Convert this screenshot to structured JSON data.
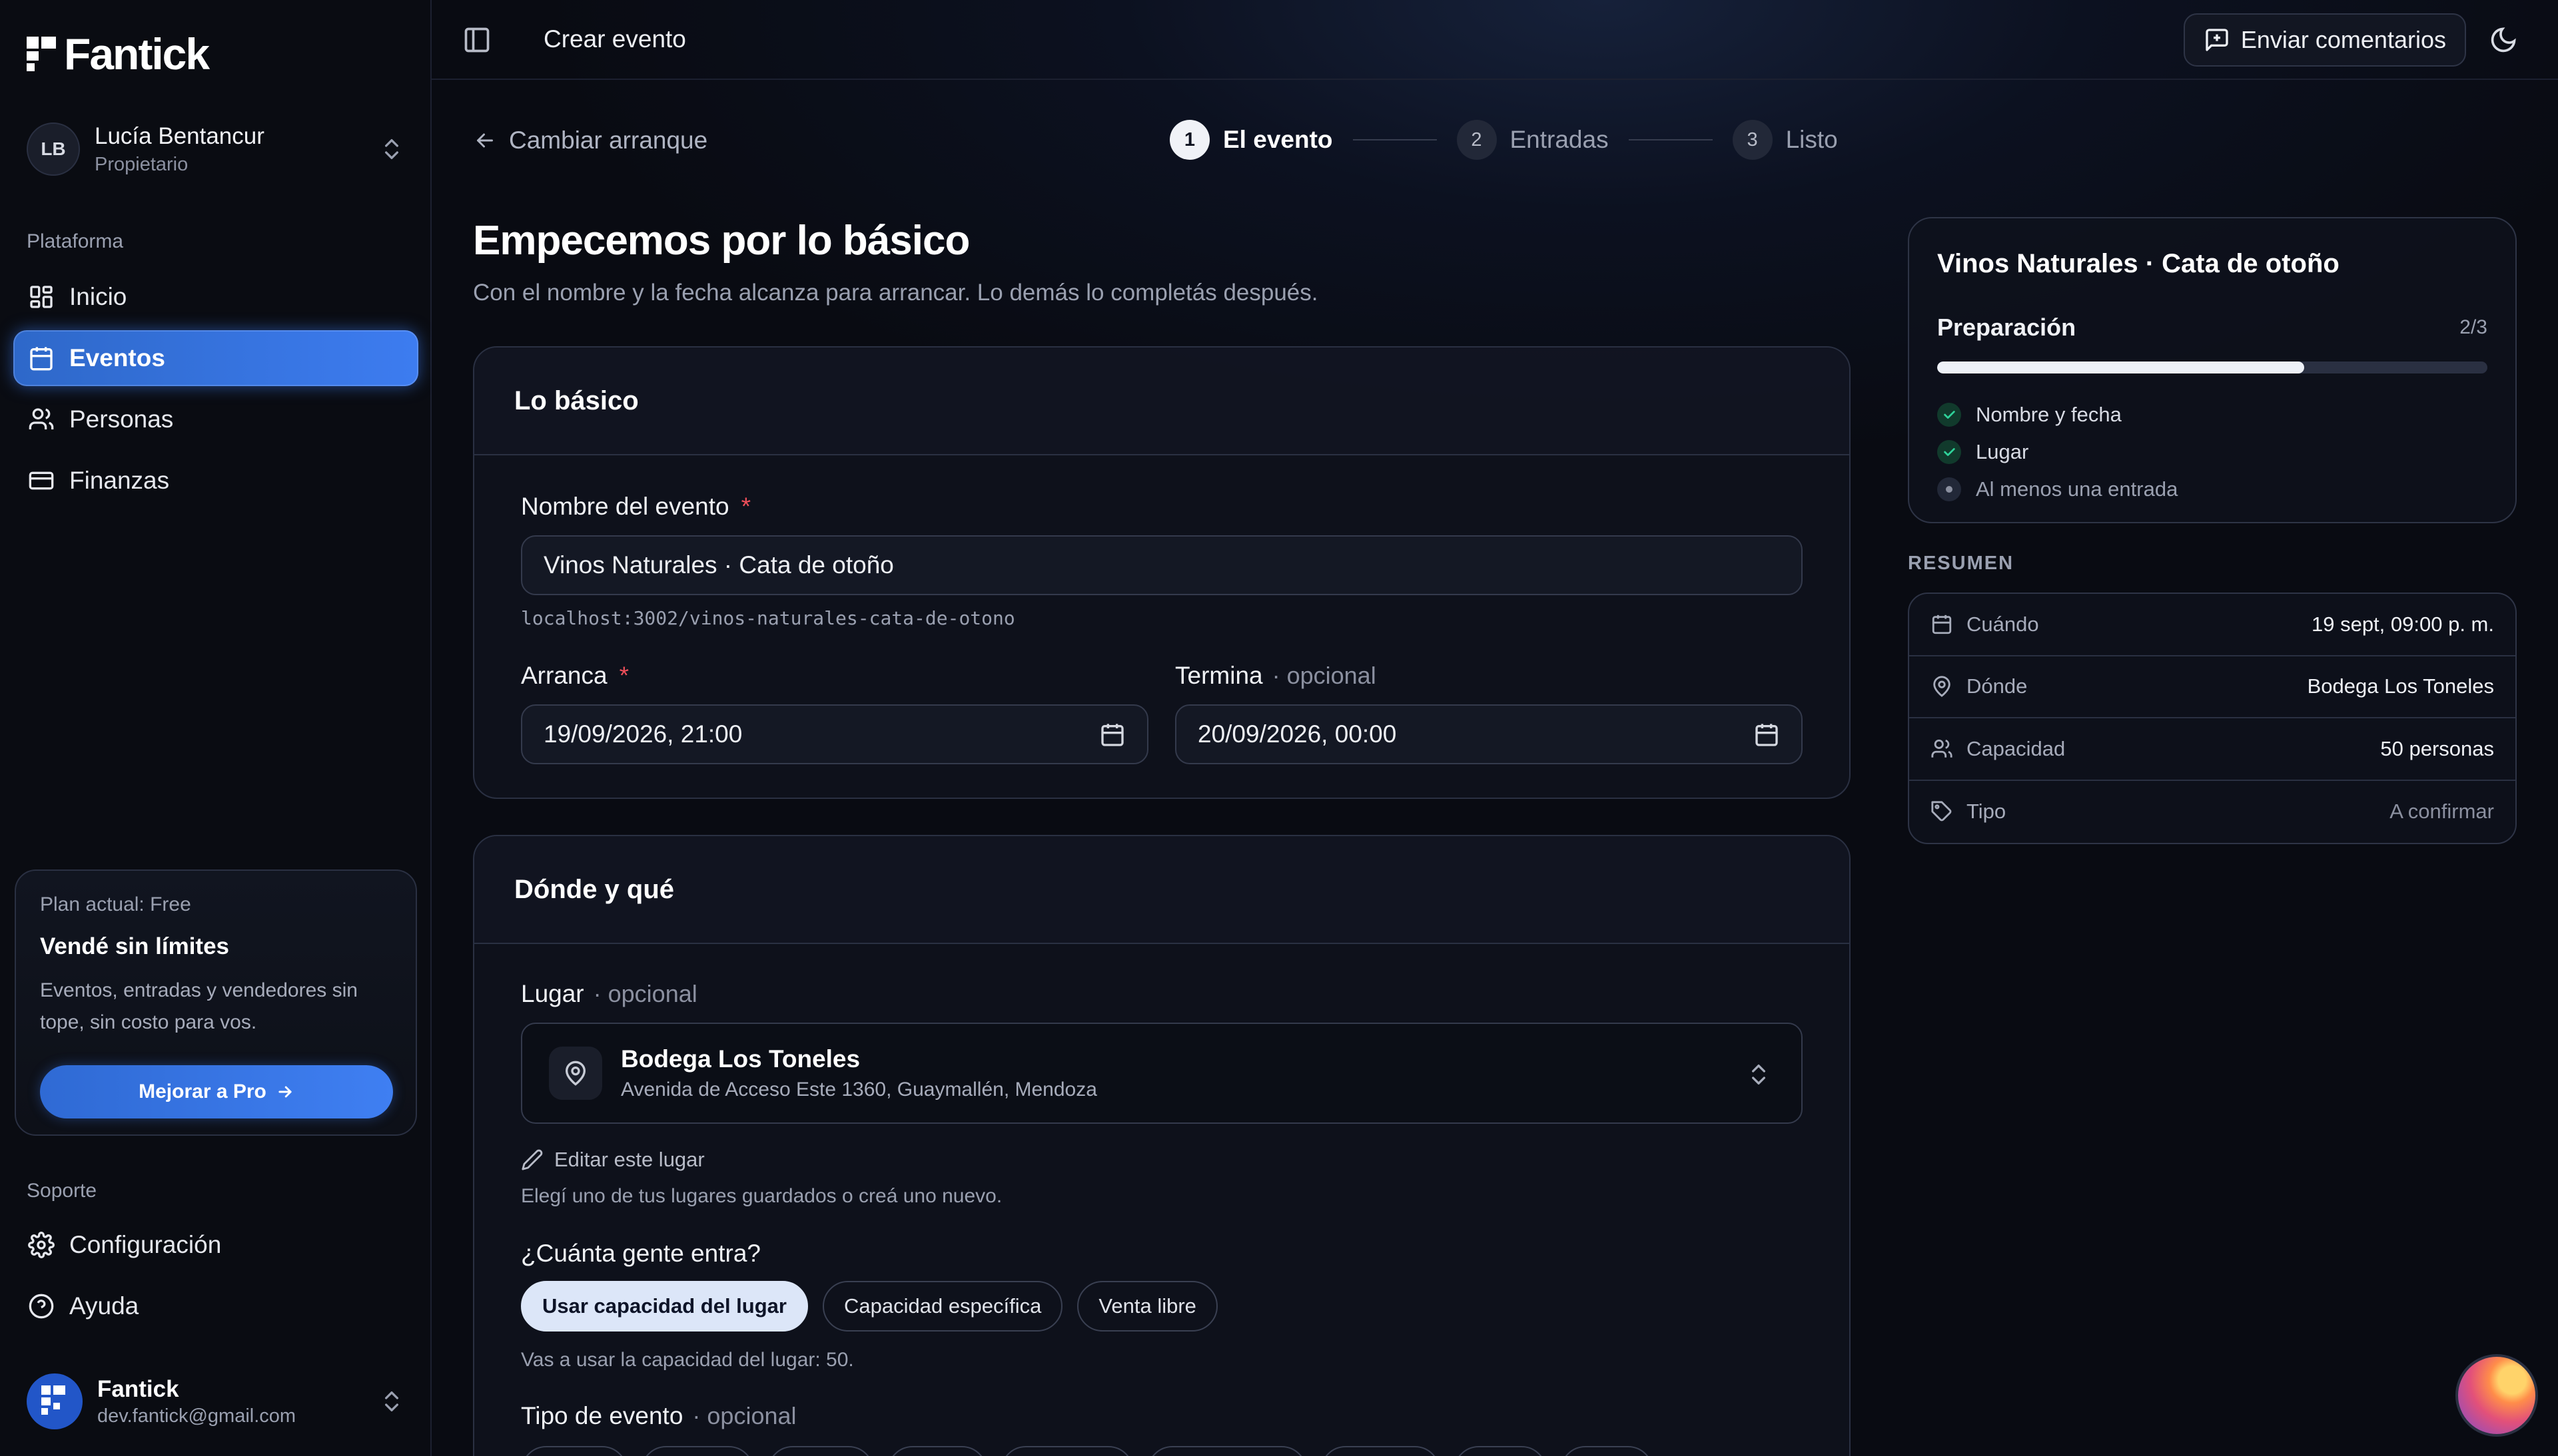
{
  "brand": {
    "name": "Fantick"
  },
  "user": {
    "initials": "LB",
    "name": "Lucía Bentancur",
    "role": "Propietario"
  },
  "nav": {
    "section_label": "Plataforma",
    "items": [
      {
        "label": "Inicio",
        "icon": "dashboard-icon"
      },
      {
        "label": "Eventos",
        "icon": "calendar-icon",
        "active": true
      },
      {
        "label": "Personas",
        "icon": "users-icon"
      },
      {
        "label": "Finanzas",
        "icon": "wallet-icon"
      }
    ]
  },
  "plan": {
    "label": "Plan actual: Free",
    "title": "Vendé sin límites",
    "desc_line1": "Eventos, entradas y vendedores sin",
    "desc_line2": "tope, sin costo para vos.",
    "cta": "Mejorar a Pro"
  },
  "support": {
    "section_label": "Soporte",
    "items": [
      {
        "label": "Configuración",
        "icon": "gear-icon"
      },
      {
        "label": "Ayuda",
        "icon": "help-icon"
      }
    ]
  },
  "account": {
    "name": "Fantick",
    "email": "dev.fantick@gmail.com"
  },
  "topbar": {
    "title": "Crear evento",
    "feedback": "Enviar comentarios"
  },
  "back_link": "Cambiar arranque",
  "steps": [
    {
      "num": "1",
      "label": "El evento",
      "active": true
    },
    {
      "num": "2",
      "label": "Entradas"
    },
    {
      "num": "3",
      "label": "Listo"
    }
  ],
  "page": {
    "title": "Empecemos por lo básico",
    "subtitle": "Con el nombre y la fecha alcanza para arrancar. Lo demás lo completás después."
  },
  "basics": {
    "heading": "Lo básico",
    "name_label": "Nombre del evento",
    "required_mark": "*",
    "name_value": "Vinos Naturales · Cata de otoño",
    "slug": "localhost:3002/vinos-naturales-cata-de-otono",
    "start_label": "Arranca",
    "start_value": "19/09/2026, 21:00",
    "end_label": "Termina",
    "optional": "· opcional",
    "end_value": "20/09/2026, 00:00"
  },
  "where": {
    "heading": "Dónde y qué",
    "venue_label": "Lugar",
    "venue_name": "Bodega Los Toneles",
    "venue_address": "Avenida de Acceso Este 1360, Guaymallén, Mendoza",
    "edit_venue": "Editar este lugar",
    "venue_hint": "Elegí uno de tus lugares guardados o creá uno nuevo.",
    "capacity_label": "¿Cuánta gente entra?",
    "capacity_options": [
      "Usar capacidad del lugar",
      "Capacidad específica",
      "Venta libre"
    ],
    "capacity_selected": 0,
    "capacity_hint": "Vas a usar la capacidad del lugar: 50.",
    "type_label": "Tipo de evento"
  },
  "prep": {
    "title": "Vinos Naturales · Cata de otoño",
    "label": "Preparación",
    "count": "2/3",
    "progress": 0.667,
    "items": [
      {
        "label": "Nombre y fecha",
        "done": true
      },
      {
        "label": "Lugar",
        "done": true
      },
      {
        "label": "Al menos una entrada",
        "done": false
      }
    ]
  },
  "summary": {
    "label": "RESUMEN",
    "rows": [
      {
        "key": "Cuándo",
        "value": "19 sept, 09:00 p. m.",
        "icon": "calendar-icon"
      },
      {
        "key": "Dónde",
        "value": "Bodega Los Toneles",
        "icon": "map-pin-icon"
      },
      {
        "key": "Capacidad",
        "value": "50 personas",
        "icon": "users-icon"
      },
      {
        "key": "Tipo",
        "value": "A confirmar",
        "icon": "tag-icon",
        "muted": true
      }
    ]
  },
  "colors": {
    "accent": "#3d7cf0",
    "required": "#ef4f5a",
    "success": "#2fd39a",
    "background": "#090b12"
  }
}
